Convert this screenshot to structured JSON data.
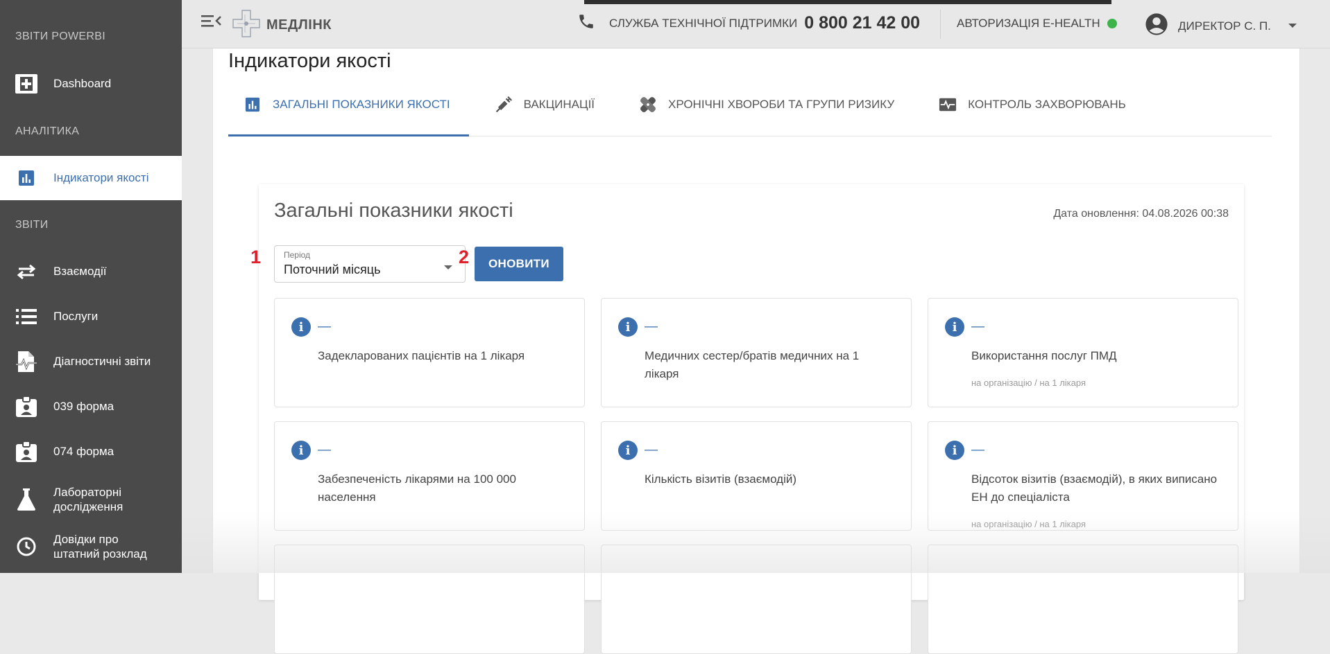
{
  "sidebar": {
    "sections": [
      {
        "label": "ЗВІТИ POWERBI"
      },
      {
        "label": "АНАЛІТИКА"
      },
      {
        "label": "ЗВІТИ"
      }
    ],
    "items": [
      {
        "label": "Dashboard",
        "icon": "dashboard-plus-icon"
      },
      {
        "label": "Індикатори якості",
        "icon": "bar-chart-icon",
        "active": true
      },
      {
        "label": "Взаємодії",
        "icon": "swap-arrows-icon"
      },
      {
        "label": "Послуги",
        "icon": "list-icon"
      },
      {
        "label": "Діагностичні звіти",
        "icon": "document-pulse-icon"
      },
      {
        "label": "039 форма",
        "icon": "badge-icon"
      },
      {
        "label": "074 форма",
        "icon": "badge-icon"
      },
      {
        "label": "Лабораторні дослідження",
        "icon": "flask-icon"
      },
      {
        "label": "Довідки про штатний розклад",
        "icon": "clock-icon"
      }
    ]
  },
  "header": {
    "logo_text": "МЕДЛІНК",
    "support_label": "СЛУЖБА ТЕХНІЧНОЇ ПІДТРИМКИ",
    "support_phone": "0 800 21 42 00",
    "ehealth_label": "АВТОРИЗАЦІЯ E-HEALTH",
    "ehealth_status_color": "#3db34a",
    "user_name": "ДИРЕКТОР С. П."
  },
  "page": {
    "title": "Індикатори якості",
    "tabs": [
      {
        "label": "ЗАГАЛЬНІ ПОКАЗНИКИ ЯКОСТІ",
        "icon": "bar-chart-icon",
        "active": true
      },
      {
        "label": "ВАКЦИНАЦІЇ",
        "icon": "syringe-icon"
      },
      {
        "label": "ХРОНІЧНІ ХВОРОБИ ТА ГРУПИ РИЗИКУ",
        "icon": "bandage-icon"
      },
      {
        "label": "КОНТРОЛЬ ЗАХВОРЮВАНЬ",
        "icon": "monitor-pulse-icon"
      }
    ]
  },
  "panel": {
    "title": "Загальні показники якості",
    "update_date": "Дата оновлення: 04.08.2026 00:38",
    "period_label": "Період",
    "period_value": "Поточний місяць",
    "refresh_label": "ОНОВИТИ",
    "marker_1": "1",
    "marker_2": "2",
    "cards": [
      {
        "value": "—",
        "title": "Задекларованих пацієнтів на 1 лікаря",
        "sub": ""
      },
      {
        "value": "—",
        "title": "Медичних сестер/братів медичних на 1 лікаря",
        "sub": ""
      },
      {
        "value": "—",
        "title": "Використання послуг ПМД",
        "sub": "на організацію / на 1 лікаря"
      },
      {
        "value": "—",
        "title": "Забезпеченість лікарями на 100 000 населення",
        "sub": ""
      },
      {
        "value": "—",
        "title": "Кількість візитів (взаємодій)",
        "sub": ""
      },
      {
        "value": "—",
        "title": "Відсоток візитів (взаємодій), в яких виписано ЕН до спеціаліста",
        "sub": "на організацію / на 1 лікаря"
      }
    ]
  },
  "colors": {
    "accent": "#3b6fae",
    "sidebar_bg": "#4a4a4a",
    "marker": "#e0202a"
  }
}
